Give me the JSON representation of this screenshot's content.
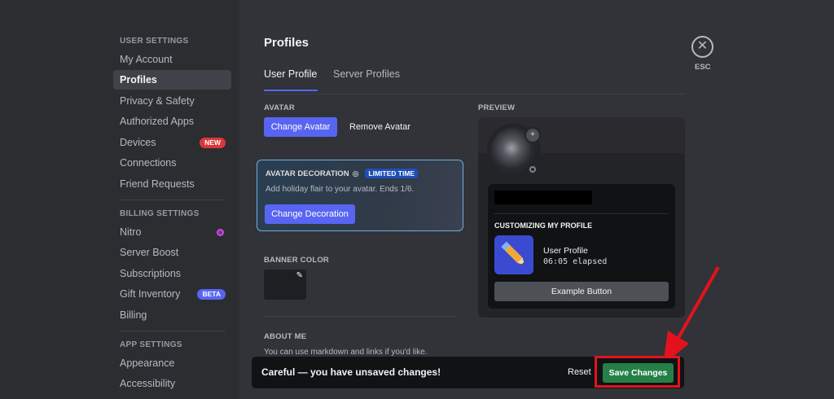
{
  "sidebar": {
    "user_settings_heading": "USER SETTINGS",
    "user_items": [
      {
        "label": "My Account"
      },
      {
        "label": "Profiles"
      },
      {
        "label": "Privacy & Safety"
      },
      {
        "label": "Authorized Apps"
      },
      {
        "label": "Devices",
        "badge": "NEW"
      },
      {
        "label": "Connections"
      },
      {
        "label": "Friend Requests"
      }
    ],
    "billing_heading": "BILLING SETTINGS",
    "billing_items": [
      {
        "label": "Nitro"
      },
      {
        "label": "Server Boost"
      },
      {
        "label": "Subscriptions"
      },
      {
        "label": "Gift Inventory",
        "badge": "BETA"
      },
      {
        "label": "Billing"
      }
    ],
    "app_heading": "APP SETTINGS",
    "app_items": [
      {
        "label": "Appearance"
      },
      {
        "label": "Accessibility"
      }
    ],
    "active_item": "Profiles"
  },
  "main": {
    "title": "Profiles",
    "tabs": [
      {
        "label": "User Profile",
        "active": true
      },
      {
        "label": "Server Profiles",
        "active": false
      }
    ],
    "avatar": {
      "label": "AVATAR",
      "change_button": "Change Avatar",
      "remove_button": "Remove Avatar"
    },
    "decoration": {
      "title": "AVATAR DECORATION",
      "badge": "LIMITED TIME",
      "description": "Add holiday flair to your avatar. Ends 1/6.",
      "button": "Change Decoration"
    },
    "banner": {
      "label": "BANNER COLOR",
      "color": "#1e1f22"
    },
    "about": {
      "label": "ABOUT ME",
      "placeholder": "You can use markdown and links if you'd like."
    }
  },
  "preview": {
    "label": "PREVIEW",
    "customizing_label": "CUSTOMIZING MY PROFILE",
    "activity_title": "User Profile",
    "activity_time": "06:05 elapsed",
    "example_button": "Example Button"
  },
  "close": {
    "icon": "close-icon",
    "label": "ESC"
  },
  "notice": {
    "text": "Careful — you have unsaved changes!",
    "reset": "Reset",
    "save": "Save Changes"
  },
  "colors": {
    "accent": "#5865f2",
    "save": "#248046",
    "highlight": "#e2131c"
  }
}
